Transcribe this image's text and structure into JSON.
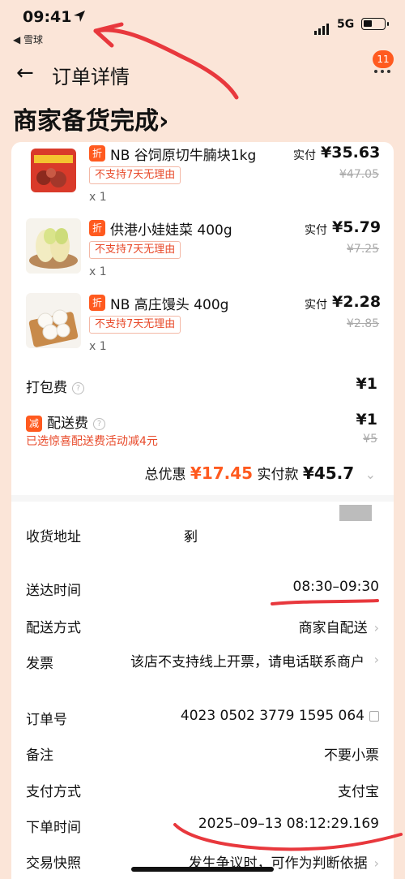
{
  "status_bar": {
    "time": "09:41",
    "back_app": "◀ 雪球",
    "network": "5G"
  },
  "nav": {
    "title": "订单详情",
    "badge_count": "11"
  },
  "order_status": {
    "heading": "商家备货完成",
    "chevron": "›"
  },
  "items": [
    {
      "tag": "折",
      "name": "NB 谷饲原切牛腩块1kg",
      "policy": "不支持7天无理由",
      "qty": "x 1",
      "paid_label": "实付",
      "paid_price": "¥35.63",
      "original_price": "¥47.05"
    },
    {
      "tag": "折",
      "name": "供港小娃娃菜 400g",
      "policy": "不支持7天无理由",
      "qty": "x 1",
      "paid_label": "实付",
      "paid_price": "¥5.79",
      "original_price": "¥7.25"
    },
    {
      "tag": "折",
      "name": "NB 高庄馒头 400g",
      "policy": "不支持7天无理由",
      "qty": "x 1",
      "paid_label": "实付",
      "paid_price": "¥2.28",
      "original_price": "¥2.85"
    }
  ],
  "fees": {
    "packing_label": "打包费",
    "packing_value": "¥1",
    "delivery_tag": "减",
    "delivery_label": "配送费",
    "delivery_value": "¥1",
    "delivery_original": "¥5",
    "delivery_promo": "已选惊喜配送费活动减4元"
  },
  "summary": {
    "discount_label": "总优惠",
    "discount_value": "¥17.45",
    "paid_label": "实付款",
    "paid_value": "¥45.7"
  },
  "details": {
    "address_label": "收货地址",
    "address_value": "剢",
    "delivery_time_label": "送达时间",
    "delivery_time_value": "08:30–09:30",
    "delivery_method_label": "配送方式",
    "delivery_method_value": "商家自配送",
    "invoice_label": "发票",
    "invoice_value": "该店不支持线上开票，请电话联系商户",
    "order_no_label": "订单号",
    "order_no_value": "4023 0502 3779 1595 064",
    "remark_label": "备注",
    "remark_value": "不要小票",
    "payment_label": "支付方式",
    "payment_value": "支付宝",
    "order_time_label": "下单时间",
    "order_time_value": "2025–09–13 08:12:29.169",
    "snapshot_label": "交易快照",
    "snapshot_value": "发生争议时，可作为判断依据"
  },
  "colors": {
    "accent": "#ff5a1f",
    "header_bg": "#fbe5d8",
    "annotation_red": "#e8383d"
  },
  "icons": [
    "location-arrow-icon",
    "signal-icon",
    "battery-icon",
    "back-arrow-icon",
    "more-icon",
    "help-icon",
    "chevron-right-icon",
    "copy-icon"
  ]
}
